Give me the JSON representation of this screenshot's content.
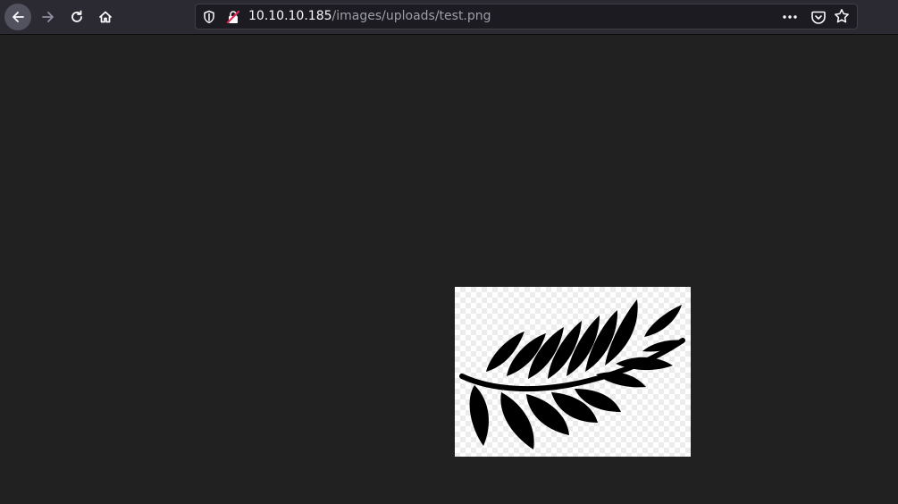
{
  "browser": {
    "url": {
      "host": "10.10.10.185",
      "path": "/images/uploads/test.png"
    },
    "icons": {
      "back": "back-arrow-icon",
      "forward": "forward-arrow-icon",
      "reload": "reload-icon",
      "home": "home-icon",
      "tracking": "shield-icon",
      "security": "insecure-lock-icon",
      "page_actions": "more-horizontal-icon",
      "pocket": "pocket-icon",
      "bookmark": "star-icon"
    },
    "colors": {
      "toolbar": "#2b2a33",
      "urlbar": "#1c1b22",
      "page_background": "#212121"
    }
  },
  "content": {
    "image": {
      "subject": "fern-leaf-icon",
      "background": "transparency-checkerboard"
    }
  }
}
